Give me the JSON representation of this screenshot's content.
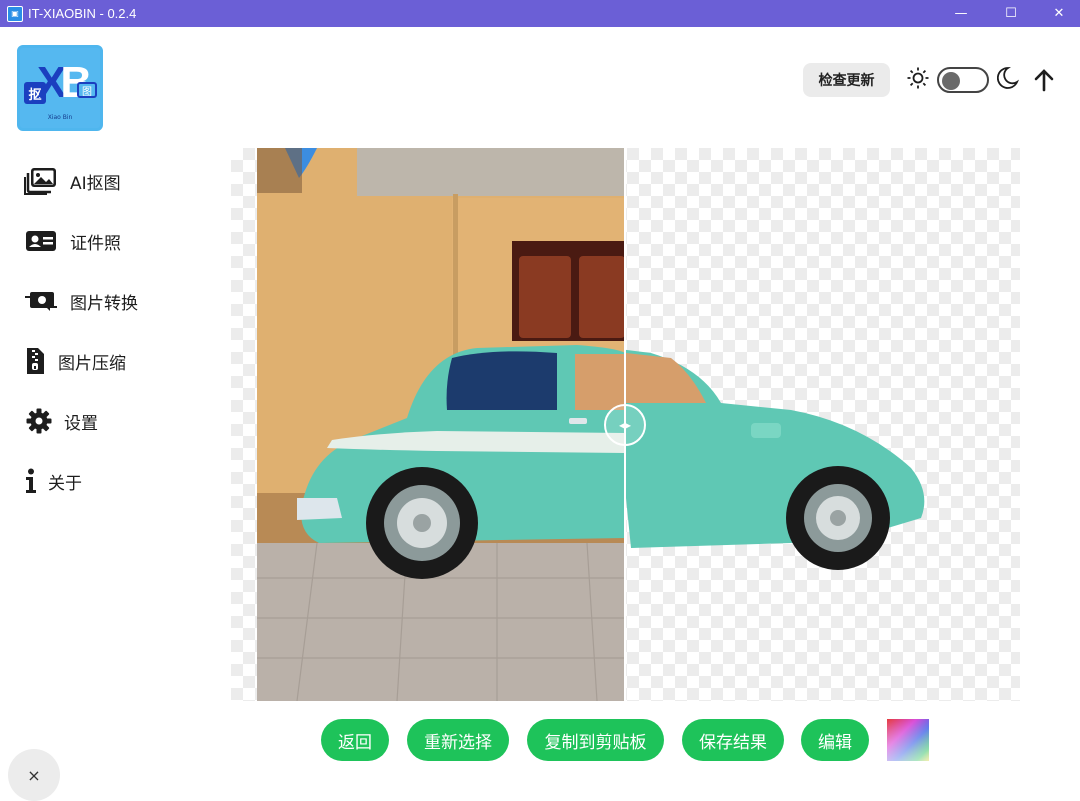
{
  "window": {
    "title": "IT-XIAOBIN - 0.2.4",
    "minimize": "—",
    "maximize": "☐",
    "close": "✕"
  },
  "logo": {
    "char1": "抠",
    "x": "X",
    "b": "B",
    "char2": "图",
    "subtitle": "Xiao Bin"
  },
  "sidebar": {
    "items": [
      {
        "label": "AI抠图",
        "icon": "image-stack-icon"
      },
      {
        "label": "证件照",
        "icon": "id-card-icon"
      },
      {
        "label": "图片转换",
        "icon": "convert-icon"
      },
      {
        "label": "图片压缩",
        "icon": "zip-file-icon"
      },
      {
        "label": "设置",
        "icon": "gear-icon"
      },
      {
        "label": "关于",
        "icon": "info-icon"
      }
    ]
  },
  "header": {
    "check_update": "检查更新",
    "theme_light": "sun-icon",
    "theme_dark": "moon-icon",
    "scroll_top": "arrow-up-icon"
  },
  "actions": {
    "back": "返回",
    "reselect": "重新选择",
    "copy": "复制到剪贴板",
    "save": "保存结果",
    "edit": "编辑"
  },
  "colors": {
    "titlebar": "#6b5fd6",
    "accent": "#1ec35a",
    "car": "#5fc8b4"
  },
  "close_fab": "×"
}
